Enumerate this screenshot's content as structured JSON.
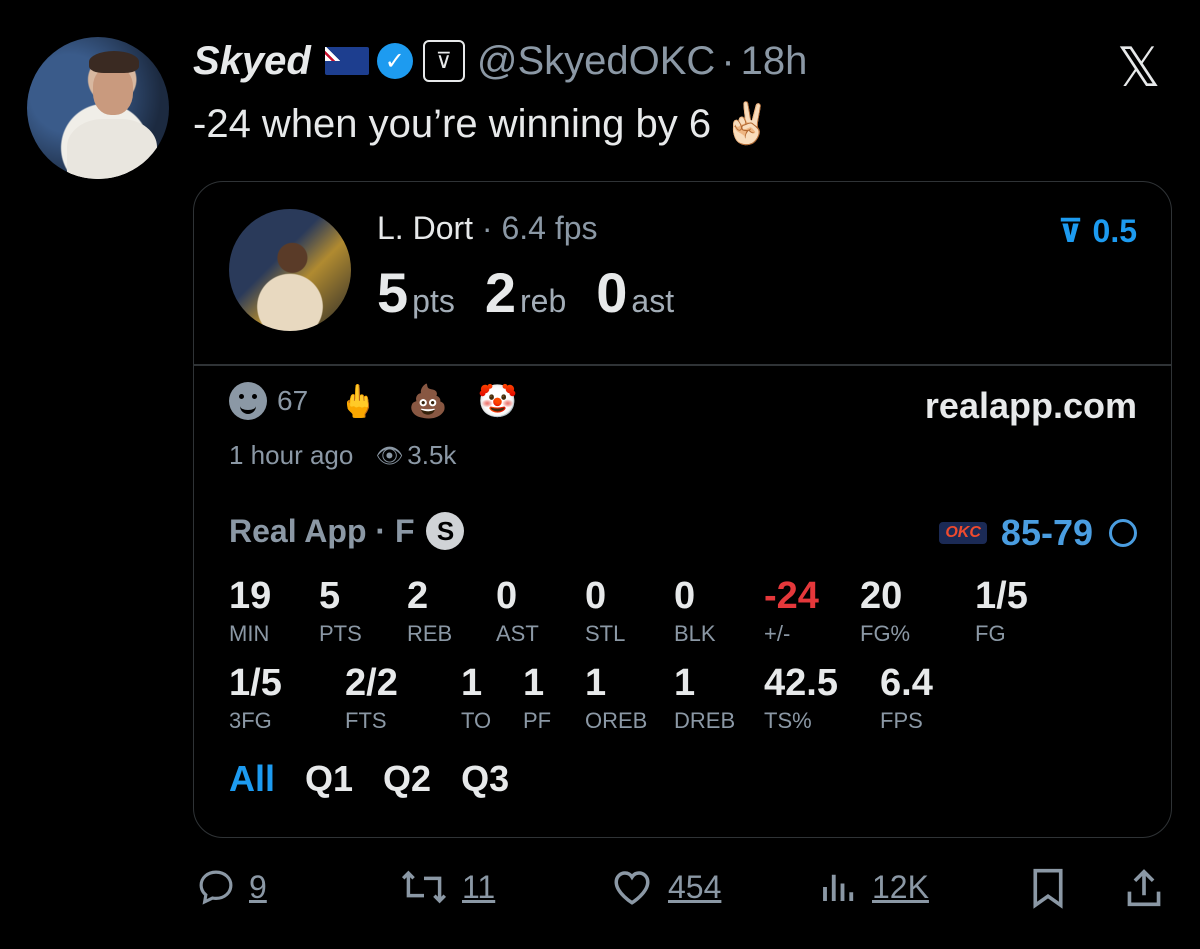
{
  "tweet": {
    "author_name": "Skyed",
    "handle": "@SkyedOKC",
    "separator": "·",
    "time": "18h",
    "text": "-24 when you’re winning by 6 ✌🏻",
    "close_icon": "x-logo-icon"
  },
  "card": {
    "player": "L. Dort",
    "player_sub": "· 6.4 fps",
    "badge": "0.5",
    "headline": [
      {
        "value": "5",
        "unit": "pts"
      },
      {
        "value": "2",
        "unit": "reb"
      },
      {
        "value": "0",
        "unit": "ast"
      }
    ],
    "reaction_count": "67",
    "emojis": [
      "🖕",
      "💩",
      "🤡"
    ],
    "site": "realapp.com",
    "time_ago": "1 hour ago",
    "views": "3.5k",
    "app_line": "Real App · F",
    "status_badge": "S",
    "score": "85-79",
    "home_team": "OKC",
    "stats_row1": [
      {
        "value": "19",
        "label": "MIN"
      },
      {
        "value": "5",
        "label": "PTS"
      },
      {
        "value": "2",
        "label": "REB"
      },
      {
        "value": "0",
        "label": "AST"
      },
      {
        "value": "0",
        "label": "STL"
      },
      {
        "value": "0",
        "label": "BLK"
      },
      {
        "value": "-24",
        "label": "+/-"
      },
      {
        "value": "20",
        "label": "FG%"
      },
      {
        "value": "1/5",
        "label": "FG"
      }
    ],
    "stats_row2": [
      {
        "value": "1/5",
        "label": "3FG"
      },
      {
        "value": "2/2",
        "label": "FTS"
      },
      {
        "value": "1",
        "label": "TO"
      },
      {
        "value": "1",
        "label": "PF"
      },
      {
        "value": "1",
        "label": "OREB"
      },
      {
        "value": "1",
        "label": "DREB"
      },
      {
        "value": "42.5",
        "label": "TS%"
      },
      {
        "value": "6.4",
        "label": "FPS"
      }
    ],
    "tabs": [
      "All",
      "Q1",
      "Q2",
      "Q3"
    ]
  },
  "actions": {
    "replies": "9",
    "retweets": "11",
    "likes": "454",
    "views": "12K"
  },
  "colors": {
    "background": "#000000",
    "accent": "#1d9bf0",
    "negative": "#e5383b",
    "muted": "#8b98a5"
  }
}
